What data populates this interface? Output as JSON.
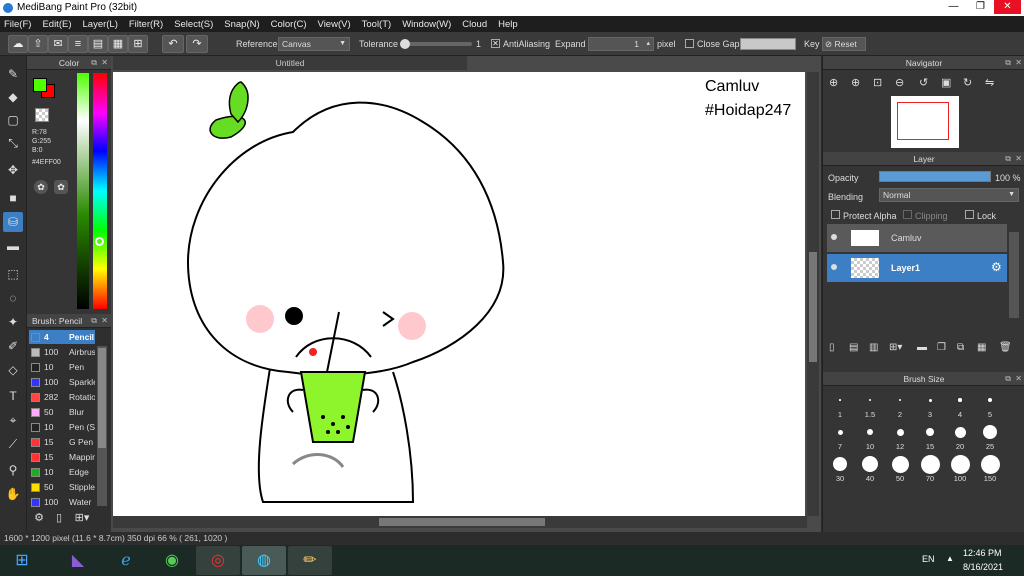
{
  "window": {
    "title": "MediBang Paint Pro (32bit)",
    "buttons": [
      "—",
      "❐",
      "✕"
    ]
  },
  "menu": [
    "File(F)",
    "Edit(E)",
    "Layer(L)",
    "Filter(R)",
    "Select(S)",
    "Snap(N)",
    "Color(C)",
    "View(V)",
    "Tool(T)",
    "Window(W)",
    "Cloud",
    "Help"
  ],
  "toolbar": {
    "reference_label": "Reference",
    "reference_value": "Canvas",
    "tolerance_label": "Tolerance",
    "tolerance_value": "1",
    "antialiasing_label": "AntiAliasing",
    "expand_label": "Expand",
    "expand_value": "1",
    "expand_unit": "pixel",
    "close_gaps_label": "Close Gaps",
    "key_label": "Key",
    "reset_label": "Reset"
  },
  "color": {
    "title": "Color",
    "r": "R:78",
    "g": "G:255",
    "b": "B:0",
    "hex": "#4EFF00",
    "foreground": "#4eff00",
    "background": "#ff0000"
  },
  "brush": {
    "title": "Brush: Pencil",
    "items": [
      {
        "size": "4",
        "name": "Pencil",
        "color": "#3d7fc4"
      },
      {
        "size": "100",
        "name": "Airbrush",
        "color": "#bbbbbb"
      },
      {
        "size": "10",
        "name": "Pen",
        "color": "#222222"
      },
      {
        "size": "100",
        "name": "Sparkle",
        "color": "#3333ff"
      },
      {
        "size": "282",
        "name": "Rotation",
        "color": "#ff4444"
      },
      {
        "size": "50",
        "name": "Blur",
        "color": "#ffaaff"
      },
      {
        "size": "10",
        "name": "Pen (S",
        "color": "#222222"
      },
      {
        "size": "15",
        "name": "G Pen",
        "color": "#ff3333"
      },
      {
        "size": "15",
        "name": "Mapping",
        "color": "#ff3333"
      },
      {
        "size": "10",
        "name": "Edge",
        "color": "#22aa22"
      },
      {
        "size": "50",
        "name": "Stipple",
        "color": "#ffdd00"
      },
      {
        "size": "100",
        "name": "Water",
        "color": "#3333ff"
      }
    ]
  },
  "document": {
    "tab": "Untitled",
    "watermark_line1": "Camluv",
    "watermark_line2": "#Hoidap247"
  },
  "navigator": {
    "title": "Navigator"
  },
  "layer": {
    "title": "Layer",
    "opacity_label": "Opacity",
    "opacity_value": "100 %",
    "opacity": 1.0,
    "blending_label": "Blending",
    "blending_value": "Normal",
    "protect_alpha": "Protect Alpha",
    "clipping": "Clipping",
    "lock": "Lock",
    "layers": [
      {
        "name": "Camluv"
      },
      {
        "name": "Layer1"
      }
    ]
  },
  "brush_size": {
    "title": "Brush Size",
    "sizes": [
      "1",
      "1.5",
      "2",
      "3",
      "4",
      "5",
      "7",
      "10",
      "12",
      "15",
      "20",
      "25",
      "30",
      "40",
      "50",
      "70",
      "100",
      "150"
    ]
  },
  "status": {
    "text": "1600 * 1200 pixel   (11.6 * 8.7cm)   350 dpi   66 %   ( 261, 1020 )"
  },
  "taskbar": {
    "lang": "EN",
    "time": "12:46 PM",
    "date": "8/16/2021"
  }
}
